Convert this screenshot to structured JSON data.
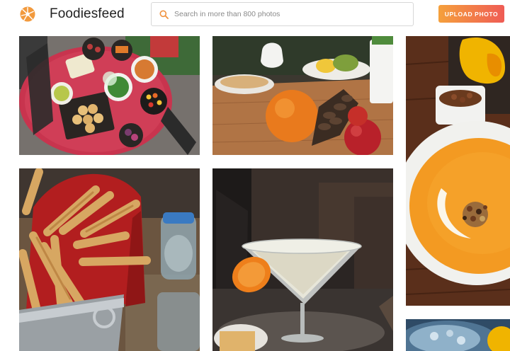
{
  "header": {
    "brand": "Foodiesfeed",
    "search_placeholder": "Search in more than 800 photos",
    "upload_label": "UPLOAD PHOTO"
  },
  "colors": {
    "accent_start": "#f5a03c",
    "accent_end": "#ef5c55",
    "search_icon": "#f0923f"
  },
  "photos": [
    {
      "subject": "picnic-table-spread"
    },
    {
      "subject": "orange-pinecone-apple"
    },
    {
      "subject": "pumpkin-soup"
    },
    {
      "subject": "breadsticks-bucket"
    },
    {
      "subject": "cocktail-glass"
    },
    {
      "subject": "blue-dish"
    }
  ]
}
